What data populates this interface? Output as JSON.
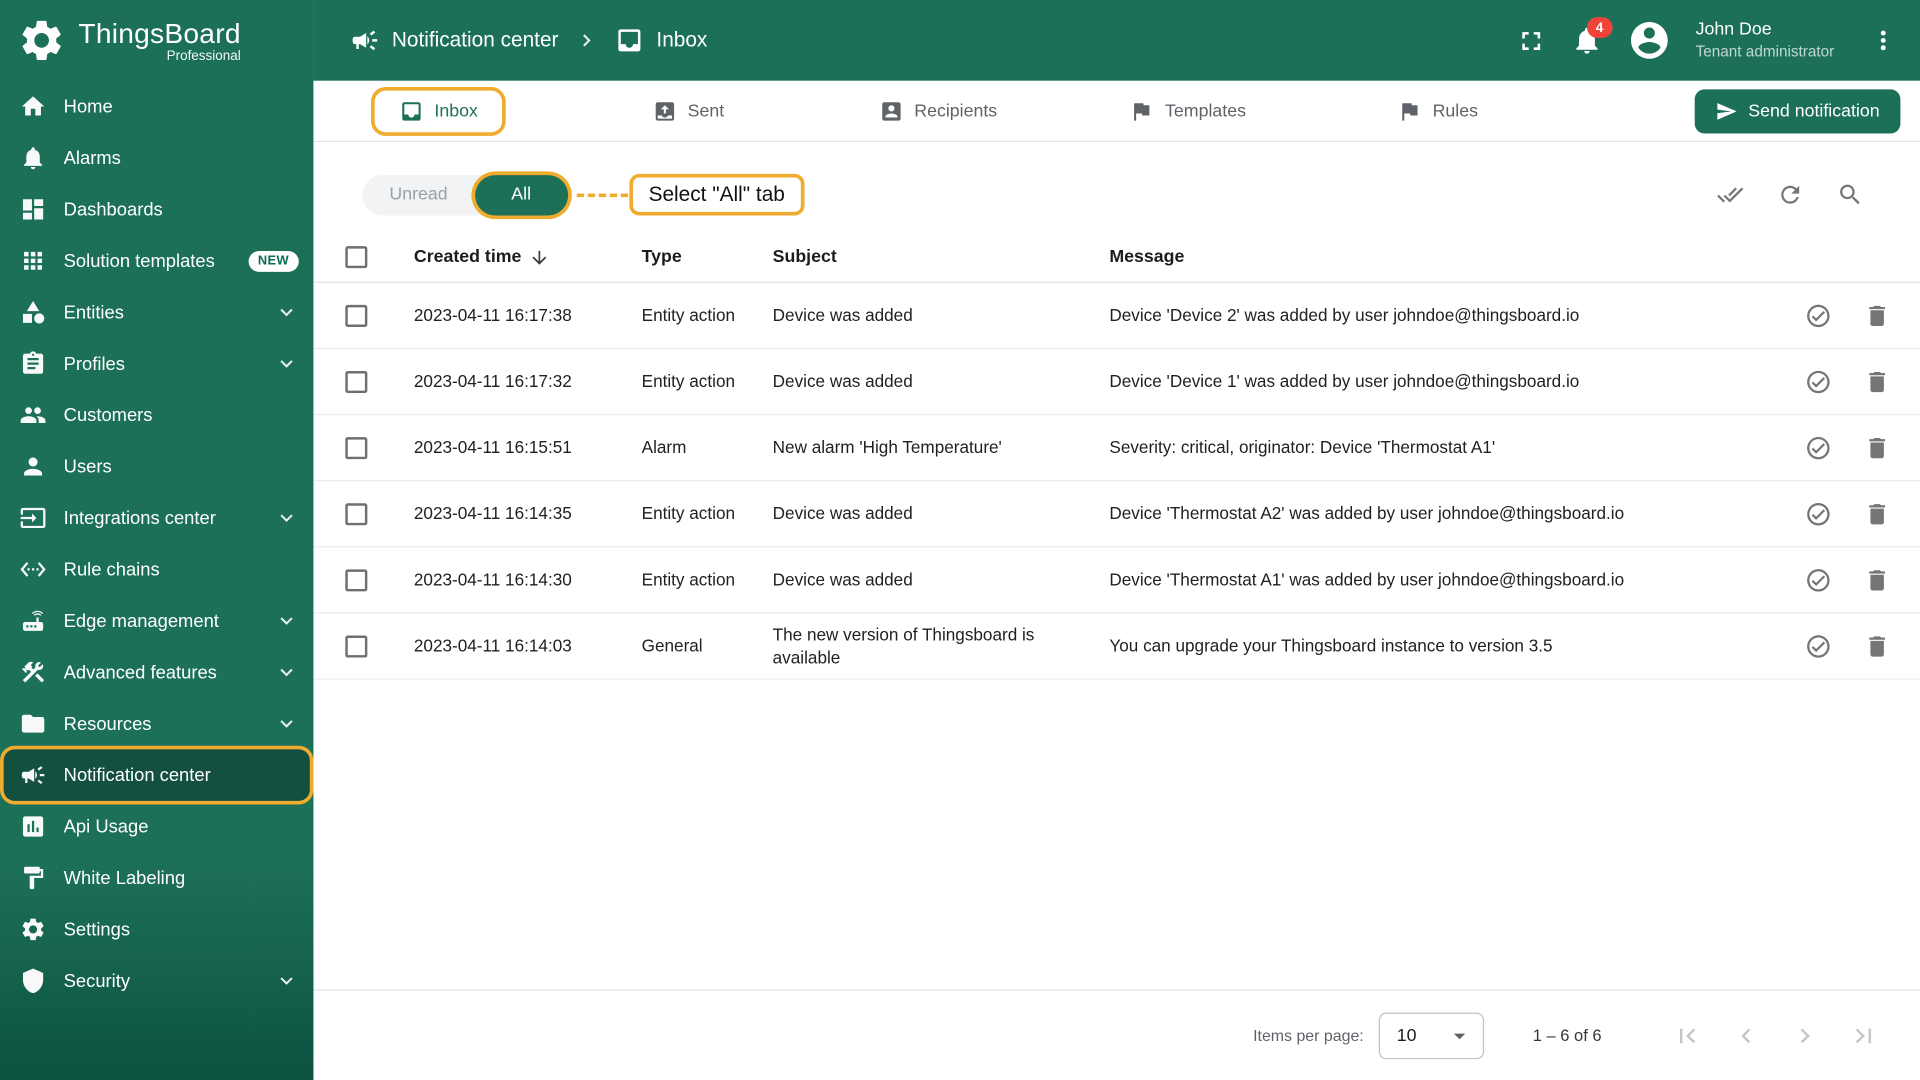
{
  "app": {
    "name": "ThingsBoard",
    "subtitle": "Professional"
  },
  "header": {
    "breadcrumb": [
      "Notification center",
      "Inbox"
    ],
    "notifications_badge": "4",
    "user_name": "John Doe",
    "user_role": "Tenant administrator"
  },
  "sidebar": {
    "items": [
      {
        "label": "Home",
        "icon": "home"
      },
      {
        "label": "Alarms",
        "icon": "bell"
      },
      {
        "label": "Dashboards",
        "icon": "dashboards"
      },
      {
        "label": "Solution templates",
        "icon": "apps",
        "badge": "NEW"
      },
      {
        "label": "Entities",
        "icon": "category",
        "expandable": true
      },
      {
        "label": "Profiles",
        "icon": "assignment",
        "expandable": true
      },
      {
        "label": "Customers",
        "icon": "people"
      },
      {
        "label": "Users",
        "icon": "person"
      },
      {
        "label": "Integrations center",
        "icon": "input",
        "expandable": true
      },
      {
        "label": "Rule chains",
        "icon": "ethernet"
      },
      {
        "label": "Edge management",
        "icon": "router",
        "expandable": true
      },
      {
        "label": "Advanced features",
        "icon": "construction",
        "expandable": true
      },
      {
        "label": "Resources",
        "icon": "folder",
        "expandable": true
      },
      {
        "label": "Notification center",
        "icon": "campaign",
        "active": true
      },
      {
        "label": "Api Usage",
        "icon": "chart"
      },
      {
        "label": "White Labeling",
        "icon": "paint"
      },
      {
        "label": "Settings",
        "icon": "settings"
      },
      {
        "label": "Security",
        "icon": "shield",
        "expandable": true
      }
    ]
  },
  "tabs": [
    {
      "label": "Inbox",
      "icon": "inbox",
      "active": true
    },
    {
      "label": "Sent",
      "icon": "outbox"
    },
    {
      "label": "Recipients",
      "icon": "recipients"
    },
    {
      "label": "Templates",
      "icon": "flag"
    },
    {
      "label": "Rules",
      "icon": "flag"
    }
  ],
  "actions": {
    "send_notification": "Send notification"
  },
  "toolbar": {
    "unread": "Unread",
    "all": "All",
    "annotation": "Select \"All\" tab"
  },
  "table": {
    "columns": {
      "created_time": "Created time",
      "type": "Type",
      "subject": "Subject",
      "message": "Message"
    },
    "rows": [
      {
        "time": "2023-04-11 16:17:38",
        "type": "Entity action",
        "subject": "Device was added",
        "message": "Device 'Device 2' was added by user johndoe@thingsboard.io",
        "read": true
      },
      {
        "time": "2023-04-11 16:17:32",
        "type": "Entity action",
        "subject": "Device was added",
        "message": "Device 'Device 1' was added by user johndoe@thingsboard.io",
        "read": true
      },
      {
        "time": "2023-04-11 16:15:51",
        "type": "Alarm",
        "subject": "New alarm 'High Temperature'",
        "message": "Severity: critical, originator: Device 'Thermostat A1'",
        "read": false
      },
      {
        "time": "2023-04-11 16:14:35",
        "type": "Entity action",
        "subject": "Device was added",
        "message": "Device 'Thermostat A2' was added by user johndoe@thingsboard.io",
        "read": false
      },
      {
        "time": "2023-04-11 16:14:30",
        "type": "Entity action",
        "subject": "Device was added",
        "message": "Device 'Thermostat A1' was added by user johndoe@thingsboard.io",
        "read": false
      },
      {
        "time": "2023-04-11 16:14:03",
        "type": "General",
        "subject": "The new version of Thingsboard is available",
        "message": "You can upgrade your Thingsboard instance to version 3.5",
        "read": false
      }
    ]
  },
  "pagination": {
    "items_per_page_label": "Items per page:",
    "page_size": "10",
    "range_label": "1 – 6 of 6"
  },
  "colors": {
    "primary_green": "#1d7058",
    "annotation_yellow": "#efac2f",
    "badge_red": "#f04438"
  }
}
